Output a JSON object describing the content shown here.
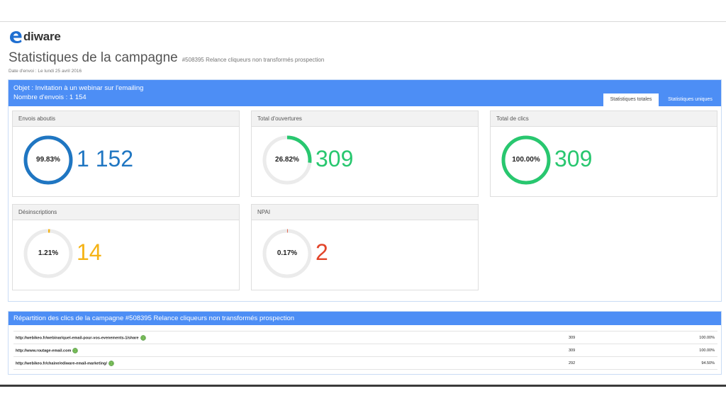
{
  "brand": {
    "name": "diware",
    "logo_letter": "e"
  },
  "page": {
    "title": "Statistiques de la campagne",
    "campaign": "#508395 Relance cliqueurs non transformés prospection",
    "send_date": "Date d'envoi : Le lundi 25 avril 2016"
  },
  "summary": {
    "subject": "Objet : Invitation à un webinar sur l'emailing",
    "sends": "Nombre d'envois : 1 154",
    "tabs": [
      {
        "label": "Statistiques totales",
        "active": true
      },
      {
        "label": "Statistiques uniques",
        "active": false
      }
    ]
  },
  "cards": [
    {
      "title": "Envois aboutis",
      "percent_label": "99.83%",
      "fraction": 0.9983,
      "value": "1 152",
      "color": "#1f76c2"
    },
    {
      "title": "Total d'ouvertures",
      "percent_label": "26.82%",
      "fraction": 0.2682,
      "value": "309",
      "color": "#28c76f"
    },
    {
      "title": "Total de clics",
      "percent_label": "100.00%",
      "fraction": 1.0,
      "value": "309",
      "color": "#28c76f"
    },
    {
      "title": "Désinscriptions",
      "percent_label": "1.21%",
      "fraction": 0.0121,
      "value": "14",
      "color": "#f5b316"
    },
    {
      "title": "NPAI",
      "percent_label": "0.17%",
      "fraction": 0.0017,
      "value": "2",
      "color": "#e2452a"
    }
  ],
  "clicks": {
    "title": "Répartition des clics de la campagne #508395 Relance cliqueurs non transformés prospection",
    "rows": [
      {
        "url": "http://webikeo.fr/webinar/quel-email-pour-vos-evenements-1/share",
        "clicks": "309",
        "percent": "100.00%"
      },
      {
        "url": "http://www.routage-email.com",
        "clicks": "309",
        "percent": "100.00%"
      },
      {
        "url": "http://webikeo.fr/chaine/ediware-email-marketing/",
        "clicks": "292",
        "percent": "94.50%"
      }
    ]
  },
  "colors": {
    "header_blue": "#4d8ef5",
    "ring_track": "#ebebeb"
  }
}
